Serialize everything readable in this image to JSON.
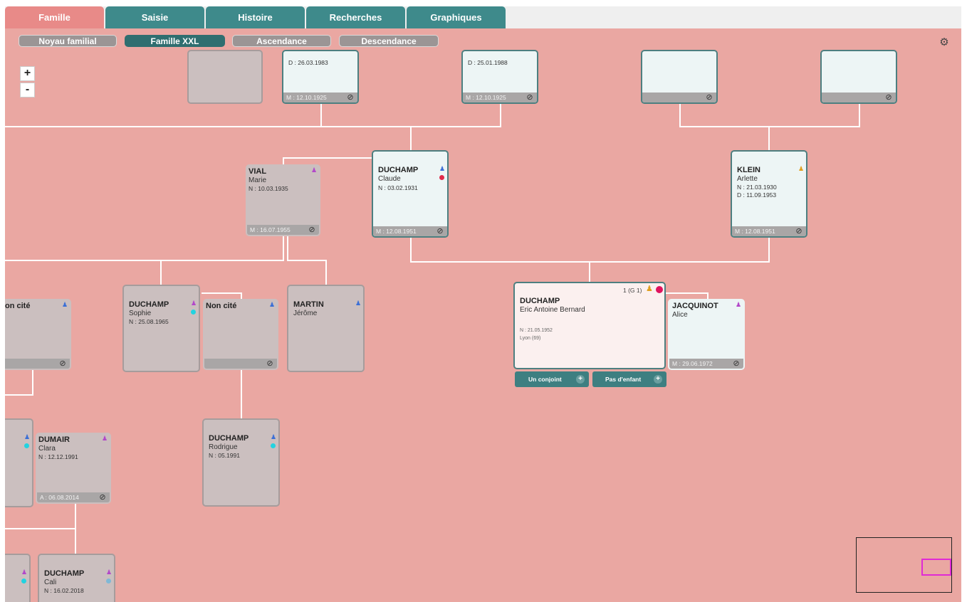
{
  "tabs": [
    "Famille",
    "Saisie",
    "Histoire",
    "Recherches",
    "Graphiques"
  ],
  "subtabs": [
    "Noyau familial",
    "Famille XXL",
    "Ascendance",
    "Descendance"
  ],
  "zoom": {
    "plus": "+",
    "minus": "-"
  },
  "icons": {
    "settings": "gear-icon",
    "link": "link-icon",
    "person": "person-icon"
  },
  "colors": {
    "canvas": "#eaa7a2",
    "tab": "#3e8a8b",
    "active_tab": "#e88a88",
    "male": "#3b6fd6",
    "female": "#b248c9"
  },
  "top_cards": [
    {
      "d": "",
      "m": ""
    },
    {
      "d": "D : 26.03.1983",
      "m": "M : 12.10.1925"
    },
    {
      "d": "D : 25.01.1988",
      "m": "M : 12.10.1925"
    },
    {
      "d": "",
      "m": ""
    },
    {
      "d": "",
      "m": ""
    }
  ],
  "people": {
    "vial": {
      "name": "VIAL",
      "first": "Marie",
      "n": "N : 10.03.1935",
      "m": "M : 16.07.1955"
    },
    "claude": {
      "name": "DUCHAMP",
      "first": "Claude",
      "n": "N : 03.02.1931",
      "m": "M : 12.08.1951"
    },
    "klein": {
      "name": "KLEIN",
      "first": "Arlette",
      "n": "N : 21.03.1930",
      "d": "D : 11.09.1953",
      "m": "M : 12.08.1951"
    },
    "noncite1": {
      "name": "on cité"
    },
    "sophie": {
      "name": "DUCHAMP",
      "first": "Sophie",
      "n": "N : 25.08.1965"
    },
    "noncite2": {
      "name": "Non cité"
    },
    "martin": {
      "name": "MARTIN",
      "first": "Jérôme"
    },
    "eric": {
      "badge": "1 (G 1)",
      "name": "DUCHAMP",
      "first": "Eric Antoine Bernard",
      "n": "N : 21.05.1952",
      "place": "Lyon (69)"
    },
    "alice": {
      "name": "JACQUINOT",
      "first": "Alice",
      "m": "M : 29.06.1972"
    },
    "clara": {
      "name": "DUMAIR",
      "first": "Clara",
      "n": "N : 12.12.1991",
      "a": "A : 06.08.2014"
    },
    "rodrigue": {
      "name": "DUCHAMP",
      "first": "Rodrigue",
      "n": "N : 05.1991"
    },
    "cali": {
      "name": "DUCHAMP",
      "first": "Cali",
      "n": "N : 16.02.2018"
    }
  },
  "buttons": {
    "spouse": "Un conjoint",
    "children": "Pas d'enfant"
  }
}
